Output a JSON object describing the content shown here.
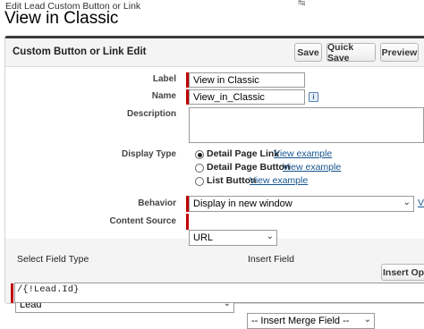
{
  "breadcrumb": "Edit Lead Custom Button or Link",
  "title": "View in Classic",
  "corner_mark": "↹",
  "panel": {
    "title": "Custom Button or Link Edit",
    "buttons": {
      "save": "Save",
      "quick_save": "Quick Save",
      "preview": "Preview"
    }
  },
  "form": {
    "label_label": "Label",
    "label_value": "View in Classic",
    "name_label": "Name",
    "name_value": "View_in_Classic",
    "info_icon": "i",
    "description_label": "Description",
    "display_type_label": "Display Type",
    "display_type_options": [
      {
        "label": "Detail Page Link",
        "link": "View example",
        "selected": true
      },
      {
        "label": "Detail Page Button",
        "link": "View example",
        "selected": false
      },
      {
        "label": "List Button",
        "link": "View example",
        "selected": false
      }
    ],
    "behavior_label": "Behavior",
    "behavior_value": "Display in new window",
    "behavior_link_cut": "V",
    "content_source_label": "Content Source",
    "content_source_value": "URL"
  },
  "merge": {
    "select_field_type_label": "Select Field Type",
    "select_field_type_value": "Lead",
    "insert_field_label": "Insert Field",
    "insert_field_value": "-- Insert Merge Field --",
    "insert_operator_button": "Insert Oper",
    "formula_text": "/{!Lead.Id}"
  },
  "colors": {
    "required": "#c00000",
    "link": "#15558f",
    "header_border": "#3b3b3b"
  }
}
